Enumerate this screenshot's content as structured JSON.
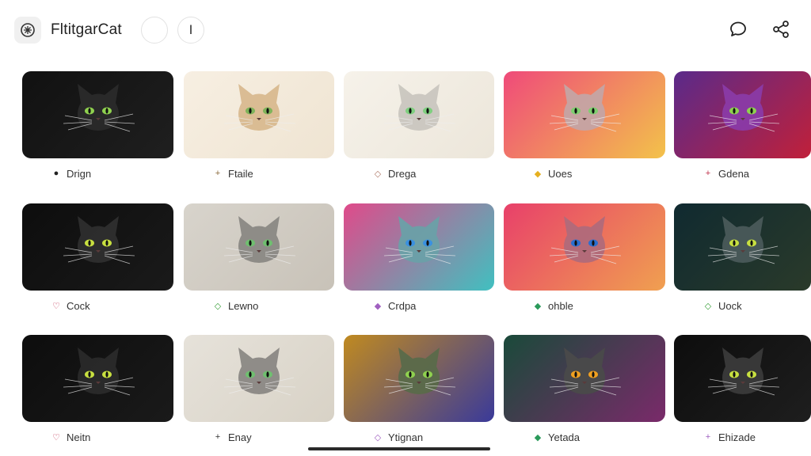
{
  "app": {
    "title": "FltitgarCat"
  },
  "header": {
    "circle_button_1": "",
    "circle_button_2": "I",
    "icons": [
      "logo-icon",
      "chat-bubble-icon",
      "share-icon"
    ]
  },
  "tiles": [
    {
      "label": "Drign",
      "glyph": "●",
      "glyph_color": "#222222",
      "bg": [
        "#111111",
        "#1f1f1f"
      ],
      "eye": "#8fd14f",
      "fur": "#2a2a2a"
    },
    {
      "label": "Ftaile",
      "glyph": "+",
      "glyph_color": "#8a6a3a",
      "bg": [
        "#f7efe2",
        "#efe4d2"
      ],
      "eye": "#7fb35a",
      "fur": "#d8b98f"
    },
    {
      "label": "Drega",
      "glyph": "◇",
      "glyph_color": "#b07a6a",
      "bg": [
        "#f6f2ea",
        "#ece6da"
      ],
      "eye": "#7fcf7f",
      "fur": "#c9c6bf"
    },
    {
      "label": "Uoes",
      "glyph": "◆",
      "glyph_color": "#e6b020",
      "bg": [
        "#ef4a7a",
        "#f3c24a"
      ],
      "eye": "#7fcf6f",
      "fur": "#c4a4a4"
    },
    {
      "label": "Gdena",
      "glyph": "+",
      "glyph_color": "#c0304a",
      "bg": [
        "#5a2a8a",
        "#c0203a"
      ],
      "eye": "#8fd14f",
      "fur": "#8a3aa6"
    },
    {
      "label": "Cock",
      "glyph": "♡",
      "glyph_color": "#c03050",
      "bg": [
        "#0d0d0d",
        "#1a1a1a"
      ],
      "eye": "#c8e040",
      "fur": "#2e2e2e"
    },
    {
      "label": "Lewno",
      "glyph": "◇",
      "glyph_color": "#3aa03a",
      "bg": [
        "#d8d4cc",
        "#c8c2b8"
      ],
      "eye": "#6fbf6f",
      "fur": "#8a8884"
    },
    {
      "label": "Crdpa",
      "glyph": "◆",
      "glyph_color": "#a060c0",
      "bg": [
        "#e04a8a",
        "#40c0c0"
      ],
      "eye": "#3a90e0",
      "fur": "#6aa0a8"
    },
    {
      "label": "ohble",
      "glyph": "◆",
      "glyph_color": "#2a9a5a",
      "bg": [
        "#e8406a",
        "#f0a050"
      ],
      "eye": "#2a6fd0",
      "fur": "#b06a7a"
    },
    {
      "label": "Uock",
      "glyph": "◇",
      "glyph_color": "#3aa03a",
      "bg": [
        "#102a30",
        "#2a3a2a"
      ],
      "eye": "#c8e040",
      "fur": "#4a5a5a"
    },
    {
      "label": "Neitn",
      "glyph": "♡",
      "glyph_color": "#c03050",
      "bg": [
        "#0d0d0d",
        "#1a1a1a"
      ],
      "eye": "#c8e040",
      "fur": "#2a2a2a"
    },
    {
      "label": "Enay",
      "glyph": "+",
      "glyph_color": "#333333",
      "bg": [
        "#e6e2da",
        "#d8d2c6"
      ],
      "eye": "#6fbf6f",
      "fur": "#8a8884"
    },
    {
      "label": "Ytignan",
      "glyph": "◇",
      "glyph_color": "#a060c0",
      "bg": [
        "#c08a20",
        "#3a3a9a"
      ],
      "eye": "#8fd14f",
      "fur": "#5a6a4a"
    },
    {
      "label": "Yetada",
      "glyph": "◆",
      "glyph_color": "#2a9a5a",
      "bg": [
        "#1a4a3a",
        "#7a2a6a"
      ],
      "eye": "#f0a020",
      "fur": "#4a4a4a"
    },
    {
      "label": "Ehizade",
      "glyph": "+",
      "glyph_color": "#a060c0",
      "bg": [
        "#0d0d0d",
        "#1e1e1e"
      ],
      "eye": "#c8e040",
      "fur": "#3a3a3a"
    }
  ]
}
